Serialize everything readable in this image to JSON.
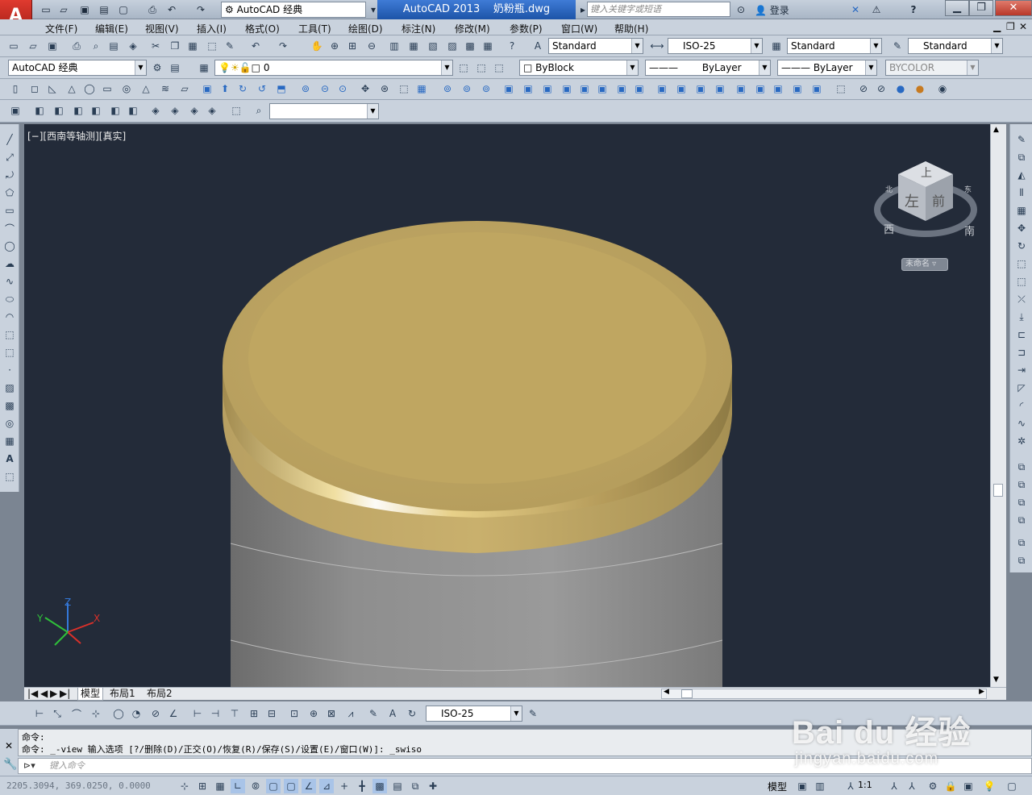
{
  "app": {
    "logo_letter": "A",
    "workspace": "AutoCAD 经典",
    "title": "AutoCAD 2013    奶粉瓶.dwg",
    "search_placeholder": "键入关键字或短语",
    "login": "登录",
    "help": "?"
  },
  "menu": [
    "文件(F)",
    "编辑(E)",
    "视图(V)",
    "插入(I)",
    "格式(O)",
    "工具(T)",
    "绘图(D)",
    "标注(N)",
    "修改(M)",
    "参数(P)",
    "窗口(W)",
    "帮助(H)"
  ],
  "styles": {
    "text_style": "Standard",
    "dim_style": "ISO-25",
    "table_style": "Standard",
    "multileader_style": "Standard"
  },
  "layers": {
    "workspace": "AutoCAD 经典",
    "current_layer": "0",
    "color": "ByBlock",
    "linetype": "ByLayer",
    "lineweight": "ByLayer",
    "plotstyle": "BYCOLOR"
  },
  "viewport": {
    "label": "[−][西南等轴测][真实]",
    "viewcube": {
      "top": "上",
      "left": "左",
      "front": "前",
      "west": "西",
      "south": "南",
      "north": "北",
      "east": "东",
      "ucs": "未命名"
    },
    "ucs_axes": {
      "x": "X",
      "y": "Y",
      "z": "Z"
    }
  },
  "tabs": [
    "模型",
    "布局1",
    "布局2"
  ],
  "dimbar": {
    "dim_style": "ISO-25"
  },
  "command": {
    "history": [
      "命令:",
      "命令: _-view 输入选项 [?/删除(D)/正交(O)/恢复(R)/保存(S)/设置(E)/窗口(W)]: _swiso"
    ],
    "input_placeholder": "键入命令"
  },
  "status": {
    "coords": "2205.3094, 369.0250, 0.0000",
    "model": "模型",
    "scale": "1:1"
  },
  "watermark": {
    "logo": "Bai du 经验",
    "sub": "jingyan.baidu.com"
  },
  "colors": {
    "accent": "#2869c2",
    "cap_gold": "#bfa661",
    "bottle_gray": "#8a8a8a",
    "viewport_bg": "#232b39"
  }
}
